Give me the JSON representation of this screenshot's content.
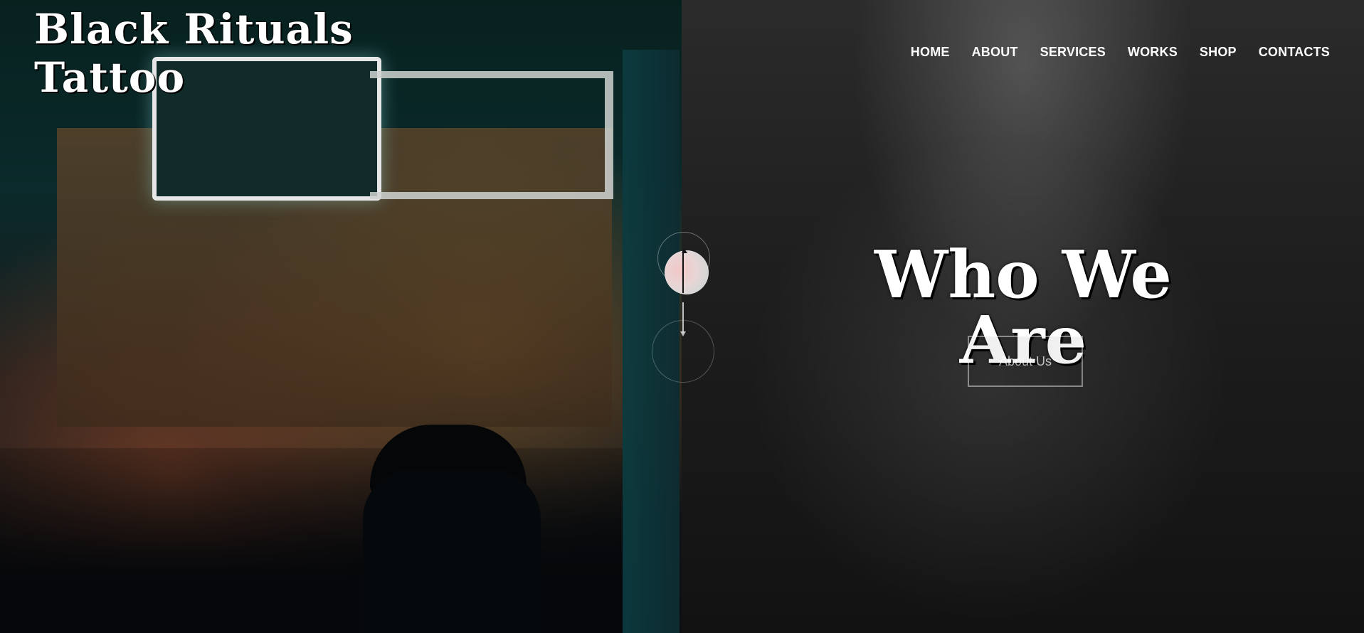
{
  "logo": {
    "text": "Black Rituals Tattoo"
  },
  "nav": {
    "items": [
      "HOME",
      "ABOUT",
      "SERVICES",
      "WORKS",
      "SHOP",
      "CONTACTS"
    ]
  },
  "hero": {
    "title": "Who We Are",
    "button_label": "About Us"
  },
  "icons": {
    "scroll": "scroll-indicator-icon",
    "arrow_down": "arrow-down-icon"
  },
  "colors": {
    "text": "#ffffff",
    "button_border": "rgba(255,255,255,0.45)"
  }
}
